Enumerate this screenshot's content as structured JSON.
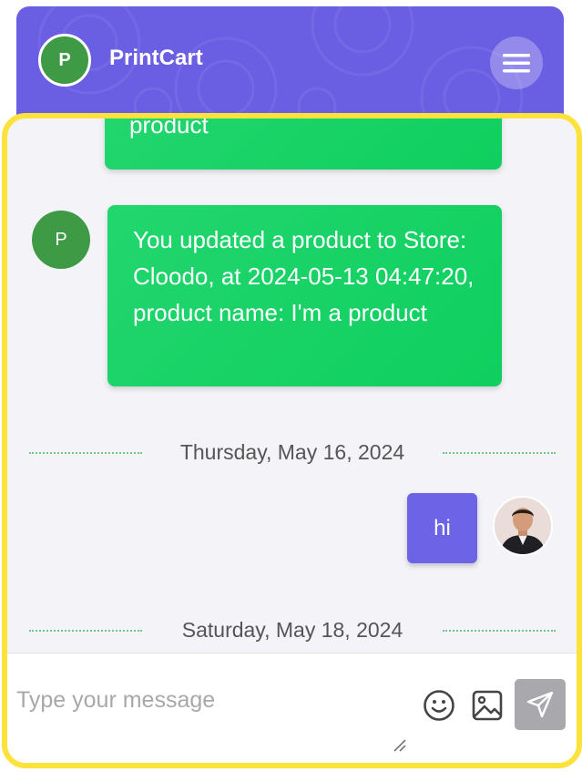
{
  "header": {
    "avatar_initial": "P",
    "title": "PrintCart",
    "menu_icon": "hamburger-icon",
    "background_color": "#6a5ee3"
  },
  "messages": [
    {
      "type": "system",
      "text": "product",
      "avatar_initial": "",
      "color": "#19d466"
    },
    {
      "type": "system",
      "avatar_initial": "P",
      "text": "You updated a product to Store: Cloodo, at 2024-05-13 04:47:20, product name: I'm a product",
      "color": "#19d466"
    }
  ],
  "dividers": [
    {
      "label": "Thursday, May 16, 2024"
    },
    {
      "label": "Saturday, May 18, 2024"
    }
  ],
  "user_message": {
    "text": "hi",
    "color": "#6d63e6",
    "avatar": "user-photo"
  },
  "composer": {
    "placeholder": "Type your message",
    "value": "",
    "emoji_icon": "smiley-icon",
    "image_icon": "image-icon",
    "send_icon": "send-icon"
  },
  "accent": {
    "highlight_border": "#fde23c"
  }
}
